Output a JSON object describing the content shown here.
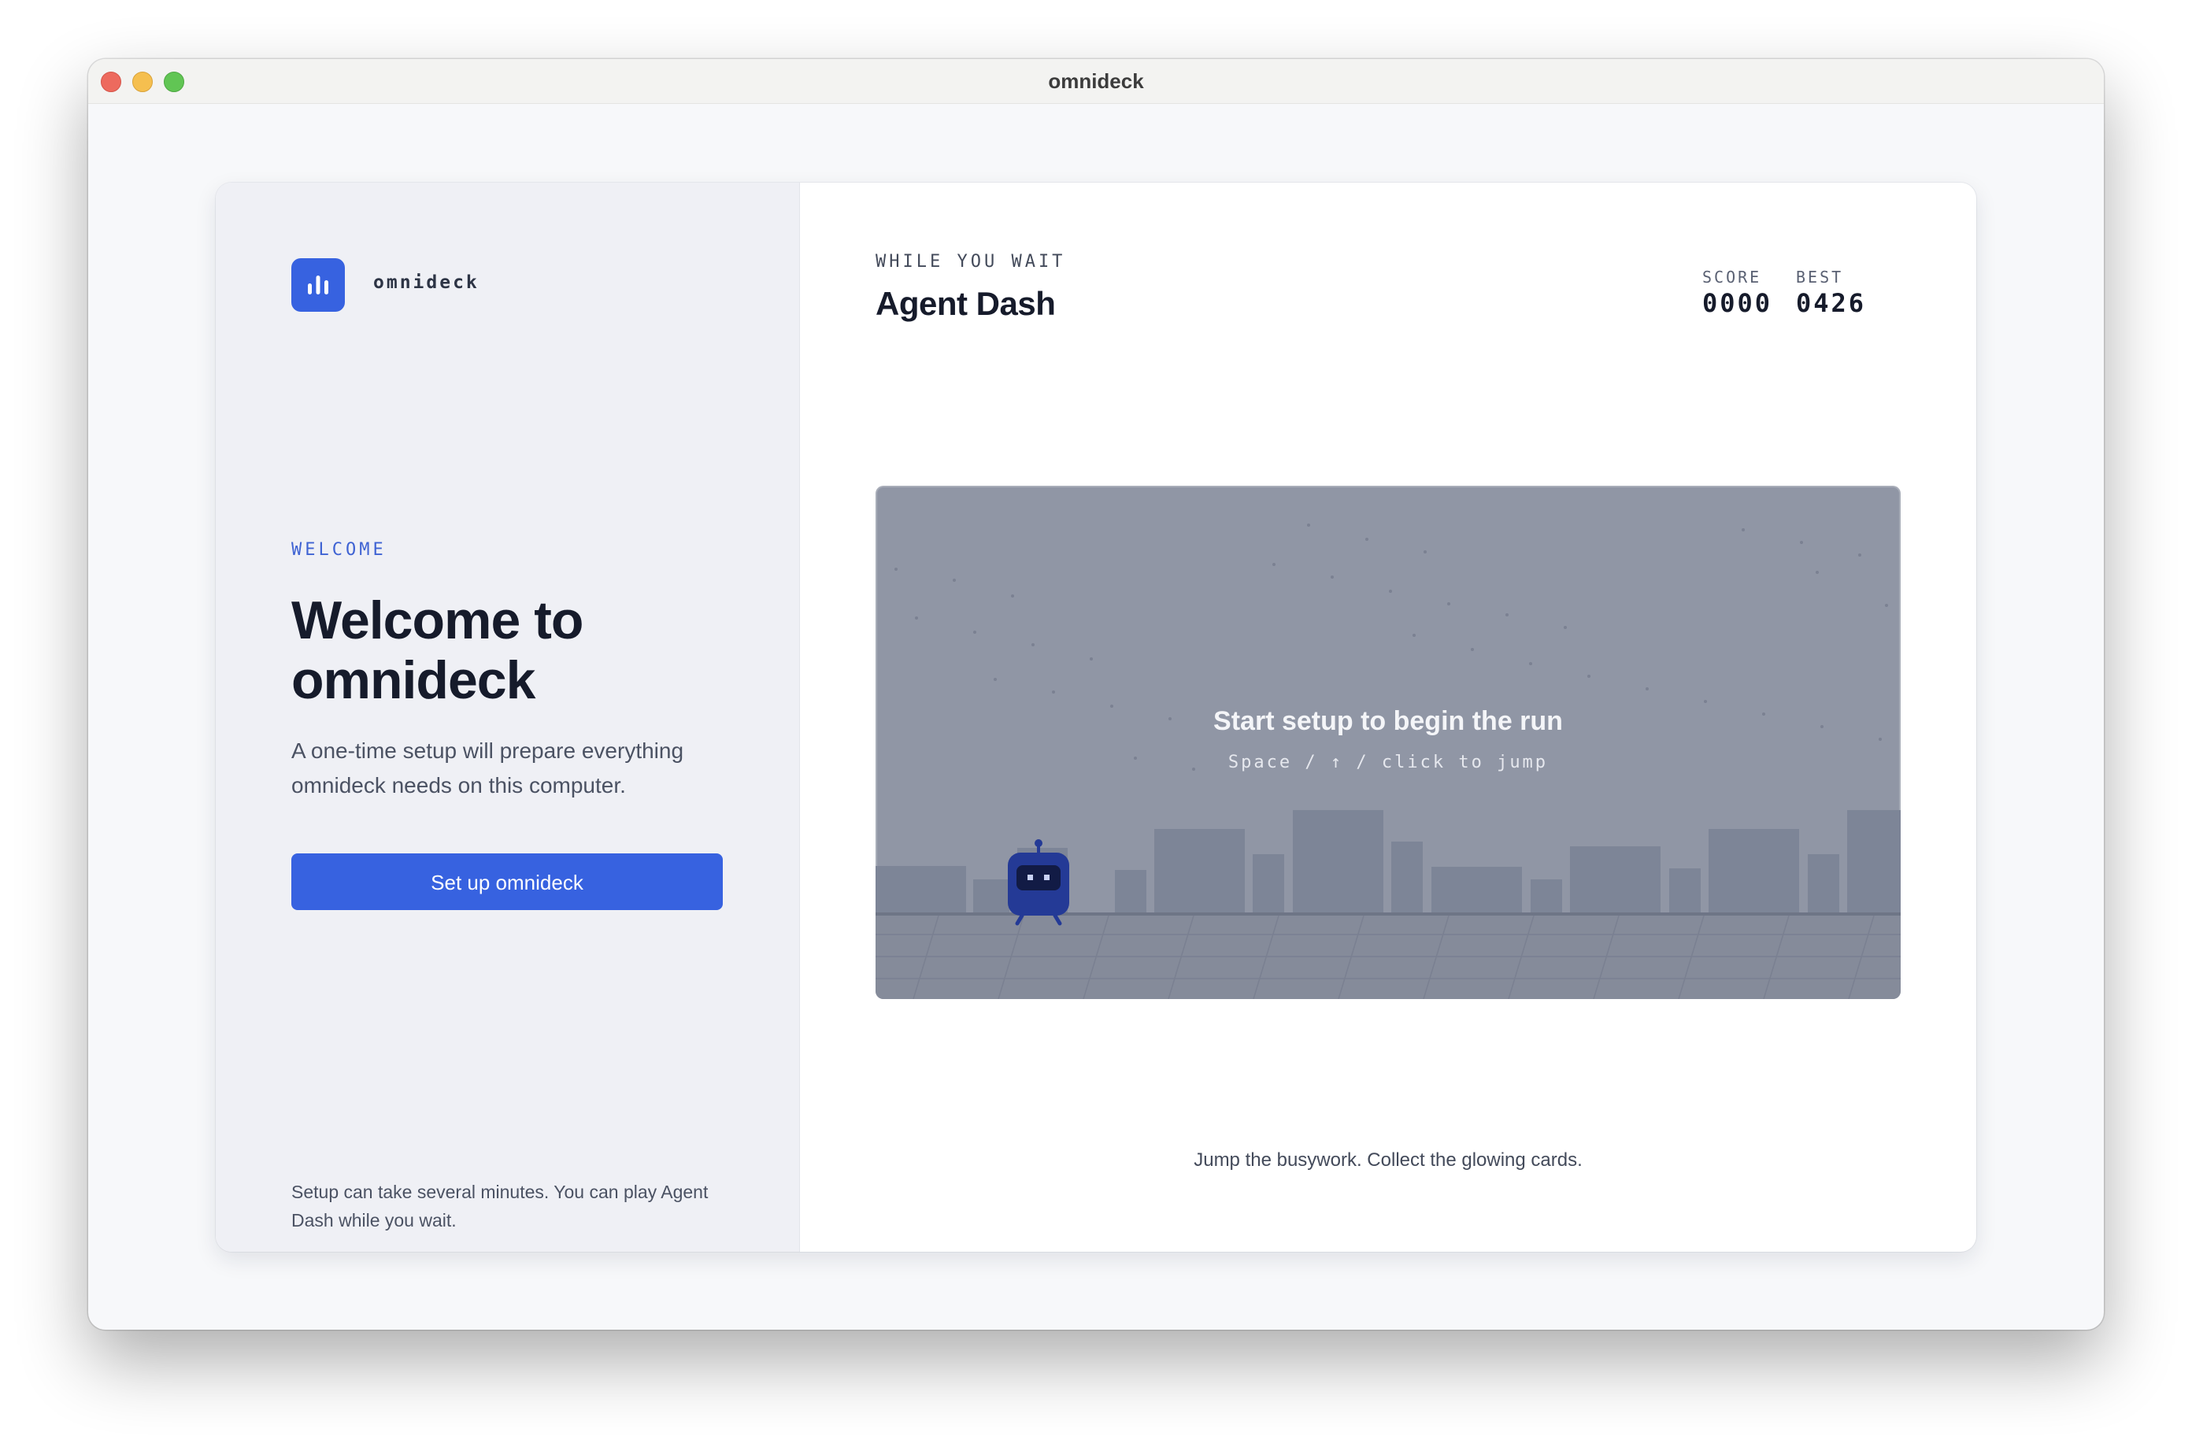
{
  "window": {
    "title": "omnideck"
  },
  "sidebar": {
    "brand": "omnideck",
    "eyebrow": "WELCOME",
    "headline": "Welcome to omnideck",
    "subtext": "A one-time setup will prepare everything omnideck needs on this computer.",
    "setup_button": "Set up omnideck",
    "note": "Setup can take several minutes. You can play Agent Dash while you wait."
  },
  "game_panel": {
    "kicker": "WHILE YOU WAIT",
    "title": "Agent Dash",
    "score_label": "SCORE",
    "score_value": "0000",
    "best_label": "BEST",
    "best_value": "0426",
    "prompt": "Start setup to begin the run",
    "hint": "Space / ↑ / click to jump",
    "tagline": "Jump the busywork. Collect the glowing cards."
  },
  "colors": {
    "accent": "#3762e0",
    "game_bg": "#9096a5",
    "robot": "#243a96"
  },
  "icons": {
    "logo": "bar-chart-icon"
  }
}
